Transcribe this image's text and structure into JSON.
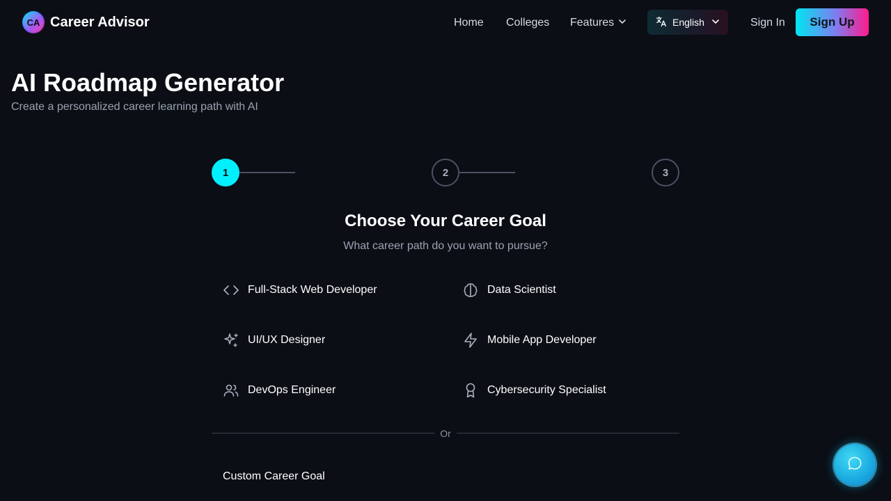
{
  "header": {
    "logo_initials": "CA",
    "brand": "Career Advisor",
    "nav": {
      "home": "Home",
      "colleges": "Colleges",
      "features": "Features"
    },
    "language": "English",
    "sign_in": "Sign In",
    "sign_up": "Sign Up"
  },
  "page": {
    "title": "AI Roadmap Generator",
    "subtitle": "Create a personalized career learning path with AI"
  },
  "stepper": {
    "steps": [
      "1",
      "2",
      "3"
    ],
    "active_step": 1
  },
  "goal_section": {
    "title": "Choose Your Career Goal",
    "subtitle": "What career path do you want to pursue?",
    "options": [
      {
        "label": "Full-Stack Web Developer",
        "icon": "code-icon"
      },
      {
        "label": "Data Scientist",
        "icon": "brain-icon"
      },
      {
        "label": "UI/UX Designer",
        "icon": "sparkles-icon"
      },
      {
        "label": "Mobile App Developer",
        "icon": "lightning-icon"
      },
      {
        "label": "DevOps Engineer",
        "icon": "users-icon"
      },
      {
        "label": "Cybersecurity Specialist",
        "icon": "award-icon"
      }
    ],
    "divider_text": "Or",
    "custom_label": "Custom Career Goal"
  },
  "colors": {
    "background": "#0b0e15",
    "accent_cyan": "#00f0ff",
    "accent_pink": "#ff1a8c",
    "muted_text": "#9aa3b2"
  }
}
